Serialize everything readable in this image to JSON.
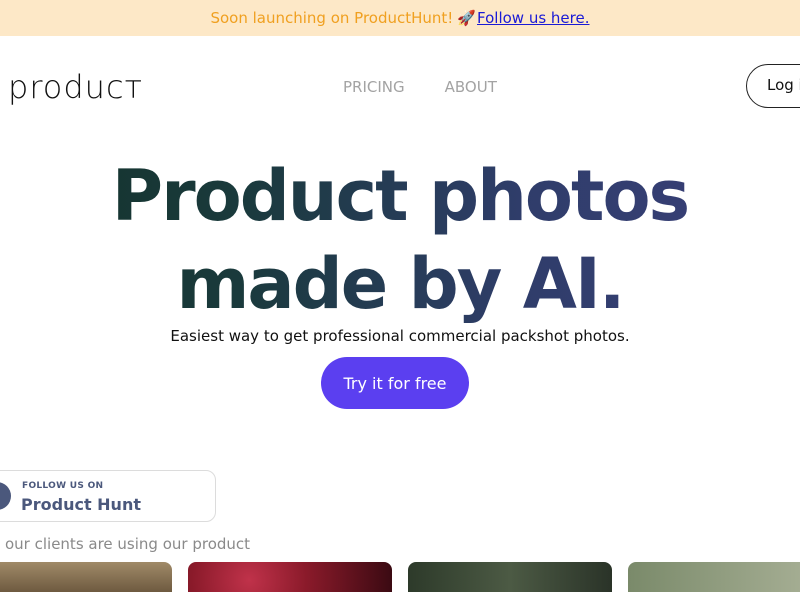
{
  "banner": {
    "text": "Soon launching on ProductHunt!",
    "emoji": "🚀",
    "link": "Follow us here."
  },
  "header": {
    "logo": "producт",
    "nav": [
      "PRICING",
      "ABOUT"
    ],
    "login_label": "Log in"
  },
  "hero": {
    "headline_line1": "Product photos",
    "headline_line2": "made by AI.",
    "subtitle": "Easiest way to get professional commercial packshot photos.",
    "cta_label": "Try it for free"
  },
  "product_hunt_badge": {
    "small": "FOLLOW US ON",
    "big": "Product Hunt"
  },
  "clients": {
    "text": "our clients are using our product"
  },
  "colors": {
    "banner_bg": "#fde8c7",
    "banner_text": "#f0a020",
    "accent": "#5b3ff0",
    "headline_start": "#13322a",
    "headline_end": "#3a3f7a",
    "product_hunt": "#4b587c"
  }
}
